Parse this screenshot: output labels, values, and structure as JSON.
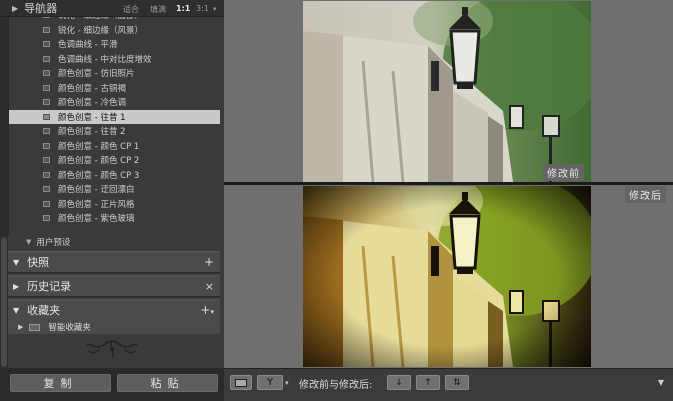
{
  "navigator": {
    "title": "导航器",
    "zoom_fit": "适合",
    "zoom_fill": "填满",
    "zoom_1": "1:1",
    "zoom_custom": "3:1"
  },
  "presets": [
    {
      "label": "锐化 - 细边缘（面部）"
    },
    {
      "label": "锐化 - 细边缘（风景）"
    },
    {
      "label": "色调曲线 - 平滑"
    },
    {
      "label": "色调曲线 - 中对比度增效"
    },
    {
      "label": "颜色创意 - 仿旧照片"
    },
    {
      "label": "颜色创意 - 古铜褐"
    },
    {
      "label": "颜色创意 - 冷色调"
    },
    {
      "label": "颜色创意 - 往昔 1",
      "selected": true
    },
    {
      "label": "颜色创意 - 往昔 2"
    },
    {
      "label": "颜色创意 - 颜色 CP 1"
    },
    {
      "label": "颜色创意 - 颜色 CP 2"
    },
    {
      "label": "颜色创意 - 颜色 CP 3"
    },
    {
      "label": "颜色创意 - 迂回漂白"
    },
    {
      "label": "颜色创意 - 正片风格"
    },
    {
      "label": "颜色创意 - 紫色玻璃"
    }
  ],
  "user_presets": {
    "label": "用户预设"
  },
  "sections": {
    "snapshots": "快照",
    "history": "历史记录",
    "collections": "收藏夹"
  },
  "smart_collections": {
    "label": "智能收藏夹"
  },
  "buttons": {
    "copy": "复制",
    "paste": "粘贴"
  },
  "view": {
    "before_label": "修改前",
    "after_label": "修改后"
  },
  "toolbar": {
    "compare_label": "修改前与修改后:"
  }
}
